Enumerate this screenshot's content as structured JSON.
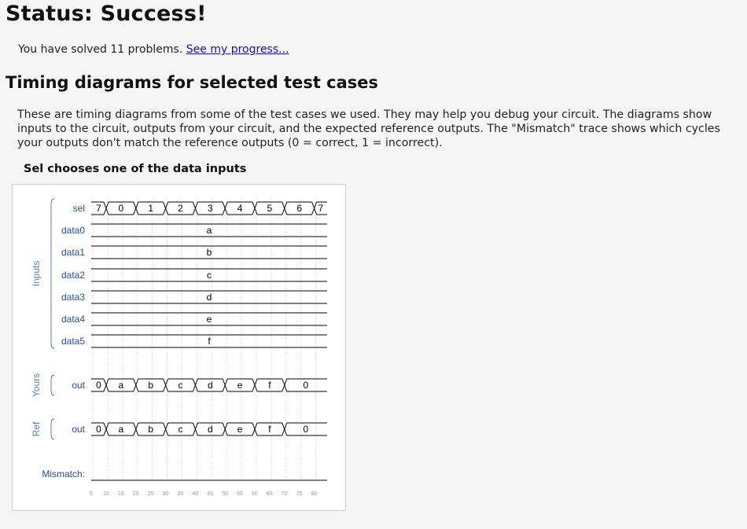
{
  "status": {
    "title": "Status: Success!"
  },
  "progress": {
    "prefix": "You have solved 11 problems.",
    "link": "See my progress..."
  },
  "section": {
    "title": "Timing diagrams for selected test cases",
    "description": "These are timing diagrams from some of the test cases we used. They may help you debug your circuit. The diagrams show inputs to the circuit, outputs from your circuit, and the expected reference outputs. The \"Mismatch\" trace shows which cycles your outputs don't match the reference outputs (0 = correct, 1 = incorrect)."
  },
  "diagram": {
    "title": "Sel chooses one of the data inputs",
    "groups": [
      "Inputs",
      "Yours",
      "Ref"
    ],
    "mismatch_label": "Mismatch:",
    "time_ticks": [
      "5",
      "10",
      "15",
      "20",
      "25",
      "30",
      "35",
      "40",
      "45",
      "50",
      "55",
      "60",
      "65",
      "70",
      "75",
      "80"
    ],
    "colors": {
      "label": "#1f4fa8",
      "group": "#5a7fc0",
      "trace": "#000000",
      "grid": "#d0d0d0",
      "tick": "#999999"
    },
    "signals": [
      {
        "name": "sel",
        "group": "Inputs",
        "kind": "bus",
        "values": [
          "7",
          "0",
          "1",
          "2",
          "3",
          "4",
          "5",
          "6",
          "7"
        ]
      },
      {
        "name": "data0",
        "group": "Inputs",
        "kind": "const",
        "value": "a"
      },
      {
        "name": "data1",
        "group": "Inputs",
        "kind": "const",
        "value": "b"
      },
      {
        "name": "data2",
        "group": "Inputs",
        "kind": "const",
        "value": "c"
      },
      {
        "name": "data3",
        "group": "Inputs",
        "kind": "const",
        "value": "d"
      },
      {
        "name": "data4",
        "group": "Inputs",
        "kind": "const",
        "value": "e"
      },
      {
        "name": "data5",
        "group": "Inputs",
        "kind": "const",
        "value": "f"
      },
      {
        "name": "out",
        "group": "Yours",
        "kind": "bus",
        "values": [
          "0",
          "a",
          "b",
          "c",
          "d",
          "e",
          "f",
          "0"
        ]
      },
      {
        "name": "out",
        "group": "Ref",
        "kind": "bus",
        "values": [
          "0",
          "a",
          "b",
          "c",
          "d",
          "e",
          "f",
          "0"
        ]
      }
    ]
  }
}
